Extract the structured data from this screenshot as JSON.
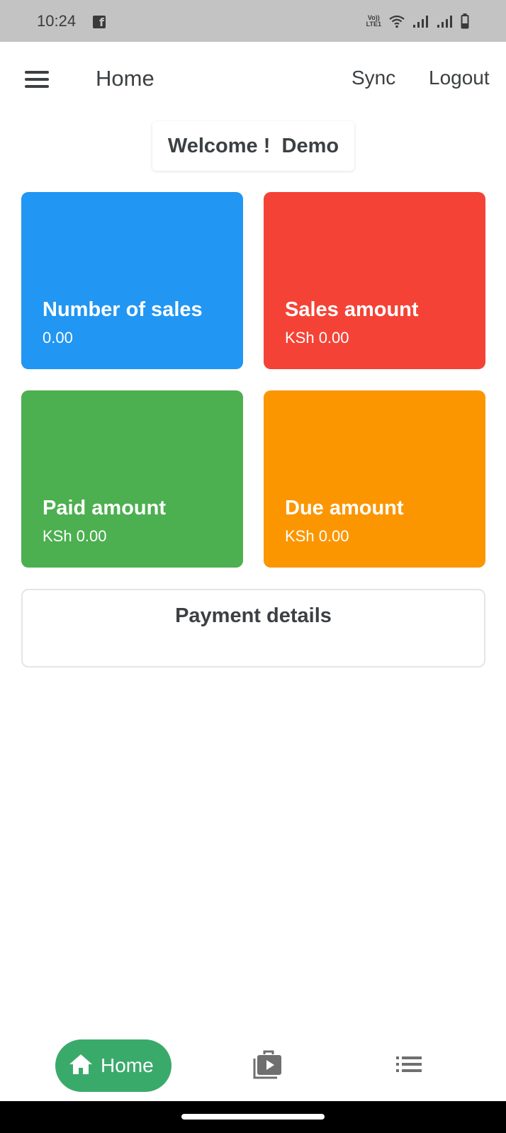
{
  "status_bar": {
    "time": "10:24",
    "volte_top": "Vo))",
    "volte_bottom": "LTE1",
    "icons": [
      "facebook-icon",
      "wifi-icon",
      "signal-icon",
      "signal-icon",
      "battery-icon"
    ]
  },
  "app_bar": {
    "title": "Home",
    "sync_label": "Sync",
    "logout_label": "Logout"
  },
  "welcome": {
    "text": "Welcome !  Demo"
  },
  "stats": {
    "sales_count": {
      "title": "Number of sales",
      "value": "0.00",
      "color": "#2196f3"
    },
    "sales_amount": {
      "title": "Sales amount",
      "value": "KSh 0.00",
      "color": "#f44336"
    },
    "paid_amount": {
      "title": "Paid amount",
      "value": "KSh 0.00",
      "color": "#4caf50"
    },
    "due_amount": {
      "title": "Due amount",
      "value": "KSh 0.00",
      "color": "#fb9600"
    }
  },
  "payment": {
    "title": "Payment details"
  },
  "bottom_nav": {
    "home_label": "Home",
    "active_color": "#3aaa6b",
    "items": [
      "home-icon",
      "products-icon",
      "list-icon"
    ]
  }
}
